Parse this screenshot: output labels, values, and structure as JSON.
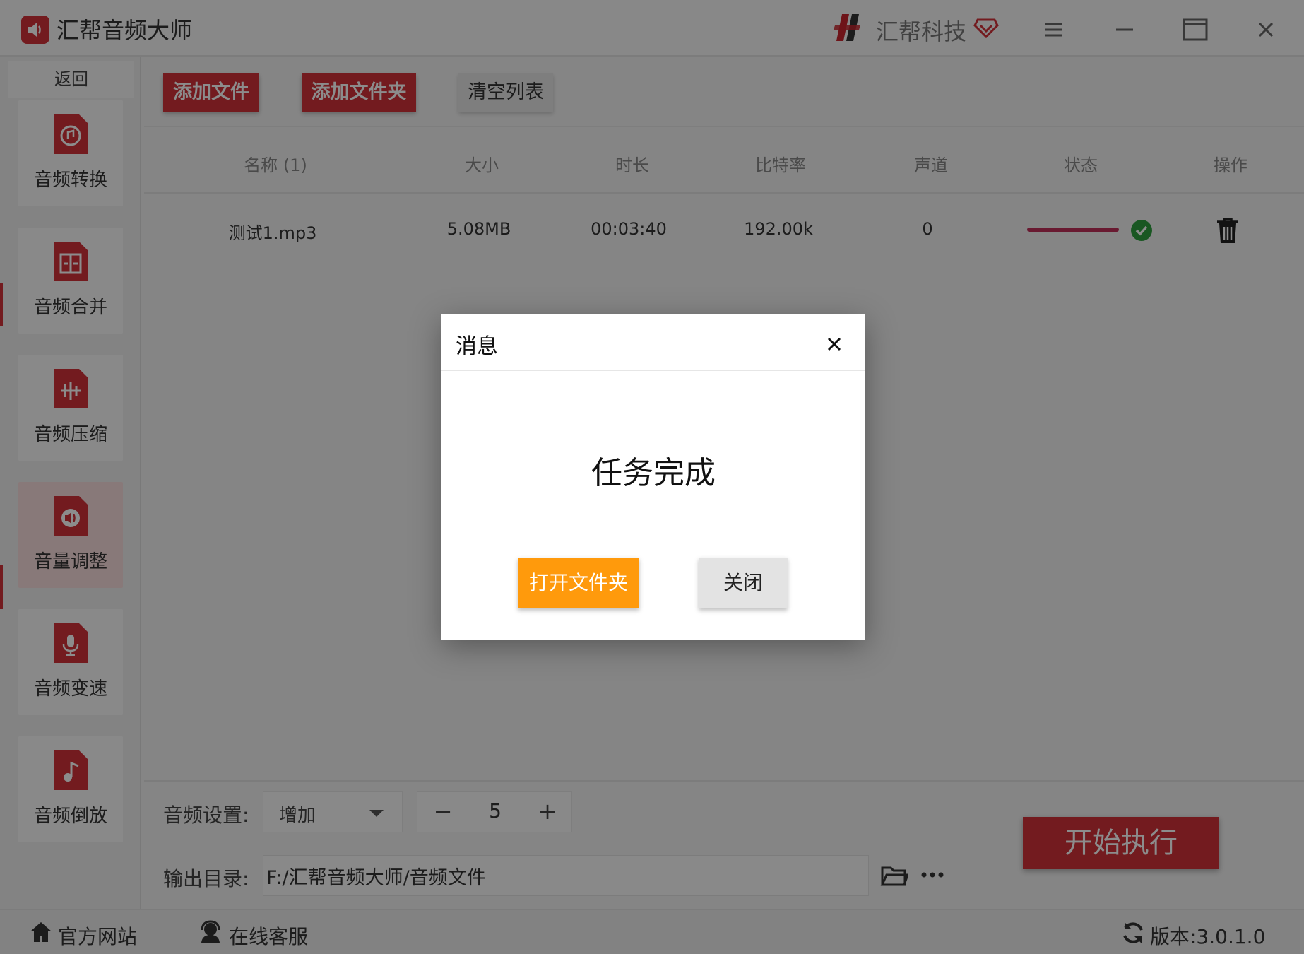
{
  "app": {
    "title": "汇帮音频大师",
    "brand": "汇帮科技",
    "accent": "#d2323a"
  },
  "sidebar": {
    "back_label": "返回",
    "tools": [
      {
        "label": "音频转换",
        "icon": "audio-convert-icon"
      },
      {
        "label": "音频合并",
        "icon": "audio-merge-icon"
      },
      {
        "label": "音频压缩",
        "icon": "audio-compress-icon"
      },
      {
        "label": "音量调整",
        "icon": "volume-adjust-icon",
        "active": true
      },
      {
        "label": "音频变速",
        "icon": "audio-speed-icon"
      },
      {
        "label": "音频倒放",
        "icon": "audio-reverse-icon"
      }
    ]
  },
  "toolbar": {
    "add_file": "添加文件",
    "add_folder": "添加文件夹",
    "clear_list": "清空列表"
  },
  "table": {
    "headers": [
      "名称 (1)",
      "大小",
      "时长",
      "比特率",
      "声道",
      "状态",
      "操作"
    ],
    "rows": [
      {
        "name": "测试1.mp3",
        "size": "5.08MB",
        "duration": "00:03:40",
        "bitrate": "192.00k",
        "channels": "0",
        "progress": 1.0,
        "status": "done"
      }
    ]
  },
  "settings": {
    "audio_label": "音频设置:",
    "mode_value": "增加",
    "step_value": "5",
    "minus": "−",
    "plus": "+",
    "output_label": "输出目录:",
    "output_path": "F:/汇帮音频大师/音频文件",
    "start_label": "开始执行"
  },
  "footer": {
    "website": "官方网站",
    "support": "在线客服",
    "version": "版本:3.0.1.0"
  },
  "dialog": {
    "title": "消息",
    "message": "任务完成",
    "open_folder": "打开文件夹",
    "close": "关闭",
    "open_color": "#ff9a0c"
  }
}
